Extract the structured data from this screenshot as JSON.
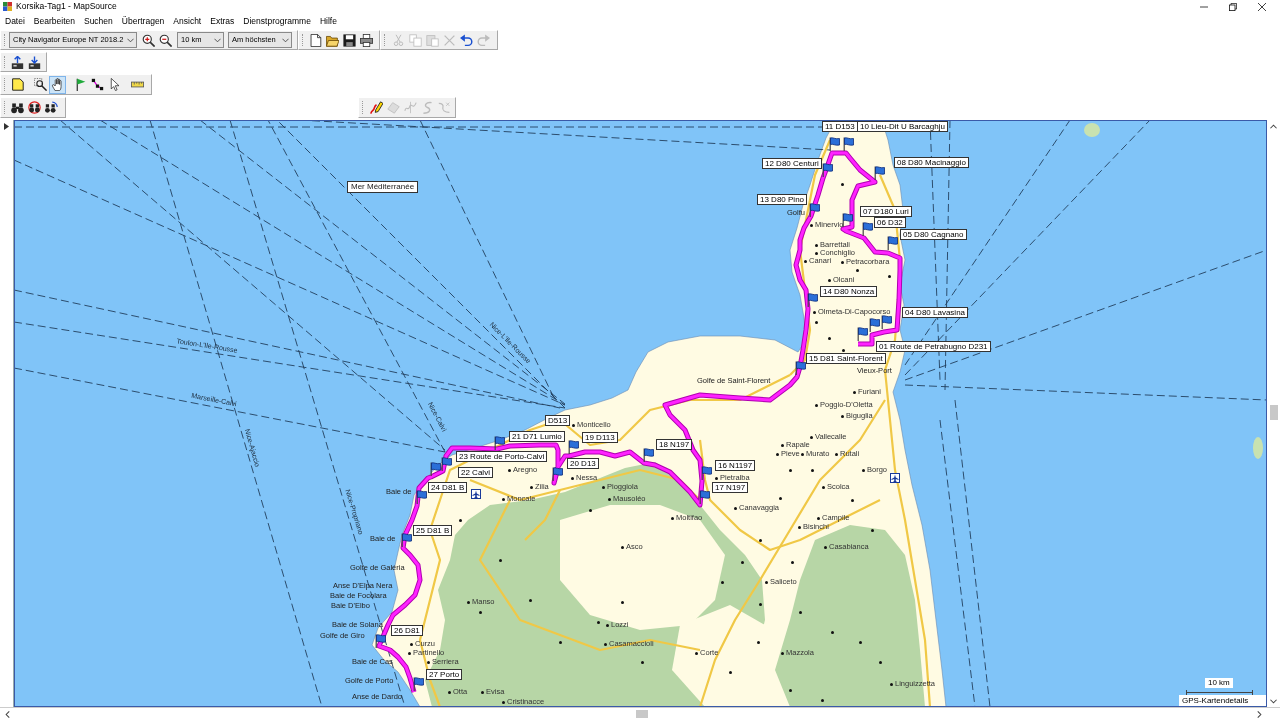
{
  "window": {
    "title": "Korsika-Tag1 - MapSource"
  },
  "menu": [
    "Datei",
    "Bearbeiten",
    "Suchen",
    "Übertragen",
    "Ansicht",
    "Extras",
    "Dienstprogramme",
    "Hilfe"
  ],
  "map_toolbar": {
    "product": "City Navigator Europe NT 2018.2",
    "zoom": "10 km",
    "detail": "Am höchsten"
  },
  "edit_buttons": [
    {
      "kind": "cut",
      "disabled": true
    },
    {
      "kind": "copy",
      "disabled": true
    },
    {
      "kind": "paste",
      "disabled": true
    },
    {
      "kind": "delete",
      "disabled": true
    },
    {
      "kind": "undo",
      "disabled": false
    },
    {
      "kind": "redo",
      "disabled": true
    }
  ],
  "tools": [
    {
      "kind": "select-map",
      "selected": false
    },
    {
      "kind": "zoom",
      "selected": false
    },
    {
      "kind": "hand",
      "selected": true
    },
    {
      "kind": "waypoint",
      "selected": false
    },
    {
      "kind": "route",
      "selected": false
    },
    {
      "kind": "select",
      "selected": false
    },
    {
      "kind": "measure",
      "selected": false
    }
  ],
  "track_tools": [
    {
      "kind": "draw-track",
      "disabled": false
    },
    {
      "kind": "erase",
      "disabled": true
    },
    {
      "kind": "split",
      "disabled": true
    },
    {
      "kind": "join",
      "disabled": true
    },
    {
      "kind": "filter",
      "disabled": true
    }
  ],
  "map": {
    "sea_label": "Mer Méditerranée",
    "ferry_routes": [
      "Toulon-L'Ile-Rousse",
      "Marseille-Calvi",
      "Nice-Calvi",
      "Nice-L'Ile-Rousse",
      "Nice-Ajaccio",
      "Nice-Propriano"
    ],
    "road_labels": [
      "D513"
    ],
    "waypoints": [
      "11 D153",
      "10 Lieu-Dit U Barcaghju",
      "12 D80 Centuri",
      "08 D80 Macinaggio",
      "13 D80 Pino",
      "07 D180 Luri",
      "06 D32",
      "05 D80 Cagnano",
      "14 D80 Nonza",
      "04 D80 Lavasina",
      "01 Route de Petrabugno D231",
      "15 D81 Saint-Florent",
      "21 D71 Lumio",
      "19 D113",
      "18 N197",
      "23 Route de Porto-Calvi",
      "20 D13",
      "16 N1197",
      "22 Calvi",
      "24 D81 B",
      "17 N197",
      "25 D81 B",
      "26 D81",
      "27 Porto"
    ],
    "water_names": [
      "Golfu",
      "Vieux-Port",
      "Golfe de Saint-Florent",
      "Baie de",
      "Baie de",
      "Golfe de Galéria",
      "Anse D'Elpa Nera",
      "Baie de Focolara",
      "Baie D'Elbo",
      "Baie de Solana",
      "Golfe de Giro",
      "Baie de Cas",
      "Golfe de Porto",
      "Anse de Dardo"
    ],
    "villages": [
      "Minervio",
      "Barrettali",
      "Conchiglio",
      "Canari",
      "Petracorbara",
      "Olcani",
      "Olmeta-Di-Capocorso",
      "Furiani",
      "Poggio-D'Oletta",
      "Biguglia",
      "Monticello",
      "Vallecalle",
      "Rapale",
      "Pieve",
      "Murato",
      "Rutali",
      "Aregno",
      "Borgo",
      "Nessa",
      "Pietralba",
      "Zilia",
      "Pioggiola",
      "Scolca",
      "Moncale",
      "Mausoléo",
      "Canavaggia",
      "Moltifao",
      "Campile",
      "Bisinchi",
      "Asco",
      "Casabianca",
      "Saliceto",
      "Manso",
      "Lozzi",
      "Curzu",
      "Casamaccioli",
      "Partinello",
      "Corte",
      "Mazzola",
      "Serriera",
      "Linguizzetta",
      "Otta",
      "Evisa",
      "Cristinacce"
    ],
    "scale": "10 km",
    "details_label": "GPS-Kartendetails"
  }
}
